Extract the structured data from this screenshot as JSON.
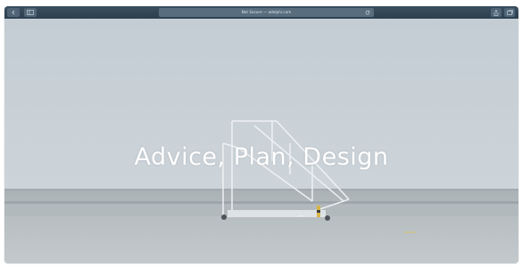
{
  "browser": {
    "address_text": "Not Secure — adelphi.com",
    "back_icon": "chevron-left-icon",
    "sidebar_icon": "sidebar-icon",
    "reload_icon": "reload-icon",
    "share_icon": "share-icon",
    "tabs_icon": "tabs-icon"
  },
  "hero": {
    "title": "Advice, Plan, Design"
  },
  "colors": {
    "toolbar": "#2c3f4f",
    "sky": "#c7d0d7",
    "ground": "#a7b0b5"
  }
}
